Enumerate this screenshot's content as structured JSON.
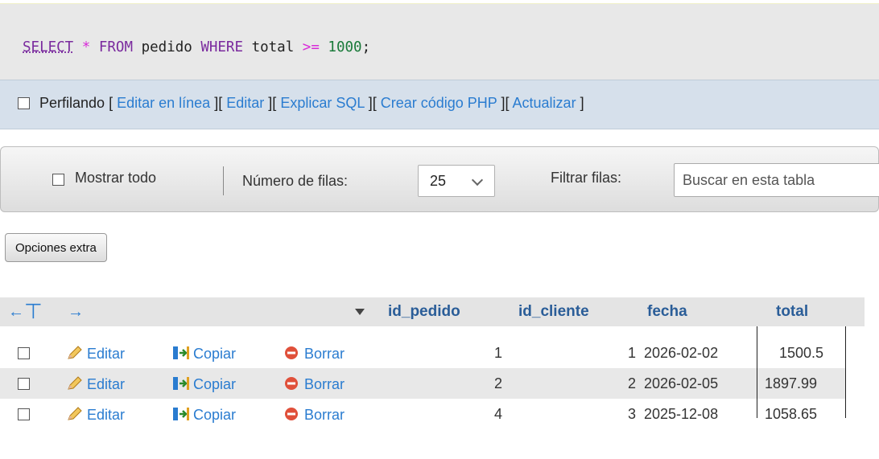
{
  "query": {
    "select": "SELECT",
    "star": "*",
    "from": "FROM",
    "table": "pedido",
    "where": "WHERE",
    "column": "total",
    "operator": ">=",
    "value": "1000",
    "terminator": ";"
  },
  "profiling": {
    "label": "Perfilando",
    "links": [
      "Editar en línea",
      "Editar",
      "Explicar SQL",
      "Crear código PHP",
      "Actualizar"
    ]
  },
  "toolbar": {
    "show_all": "Mostrar todo",
    "rows_label": "Número de filas:",
    "rows_value": "25",
    "filter_label": "Filtrar filas:",
    "search_placeholder": "Buscar en esta tabla"
  },
  "extra_options": "Opciones extra",
  "table": {
    "columns": [
      "id_pedido",
      "id_cliente",
      "fecha",
      "total"
    ],
    "actions": {
      "edit": "Editar",
      "copy": "Copiar",
      "delete": "Borrar"
    },
    "rows": [
      [
        "1",
        "1",
        "2026-02-02",
        "1500.5"
      ],
      [
        "2",
        "2",
        "2026-02-05",
        "1897.99"
      ],
      [
        "4",
        "3",
        "2025-12-08",
        "1058.65"
      ]
    ]
  },
  "colors": {
    "link": "#2a7cd0",
    "header_text": "#2a5d98",
    "keyword": "#7a2a9e"
  }
}
